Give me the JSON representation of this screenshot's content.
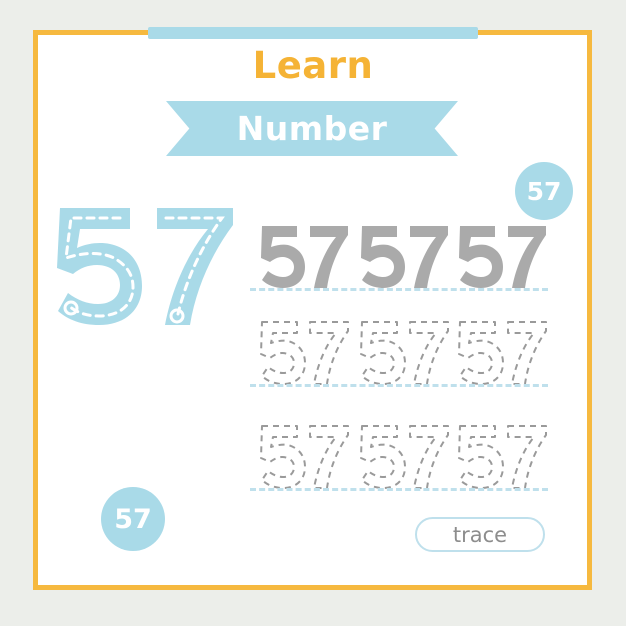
{
  "page": {
    "background_color": "#eceeea",
    "card_background": "#ffffff",
    "frame_color": "#f6b93f",
    "accent_blue": "#a9dae8",
    "accent_orange": "#f5b335",
    "gray_number_color": "#aaaaaa",
    "outline_number_color": "#9a9a9a",
    "baseline_color": "#bfe0ec"
  },
  "header": {
    "learn_label": "Learn",
    "ribbon_label": "Number"
  },
  "number": {
    "value": "57",
    "digits": [
      "5",
      "7"
    ]
  },
  "badges": {
    "top_right_label": "57",
    "bottom_left_label": "57"
  },
  "big_number": {
    "label": "57",
    "style": "filled-blue-with-dashed-trace-guide"
  },
  "practice_rows": [
    {
      "id": "row-solid",
      "style": "solid-gray",
      "items": [
        "57",
        "57",
        "57"
      ],
      "has_baseline": true
    },
    {
      "id": "row-dashed-1",
      "style": "dashed-outline",
      "items": [
        "57",
        "57",
        "57"
      ],
      "has_baseline": true
    },
    {
      "id": "row-dashed-2",
      "style": "dashed-outline",
      "items": [
        "57",
        "57",
        "57"
      ],
      "has_baseline": true
    }
  ],
  "footer": {
    "trace_label": "trace"
  }
}
